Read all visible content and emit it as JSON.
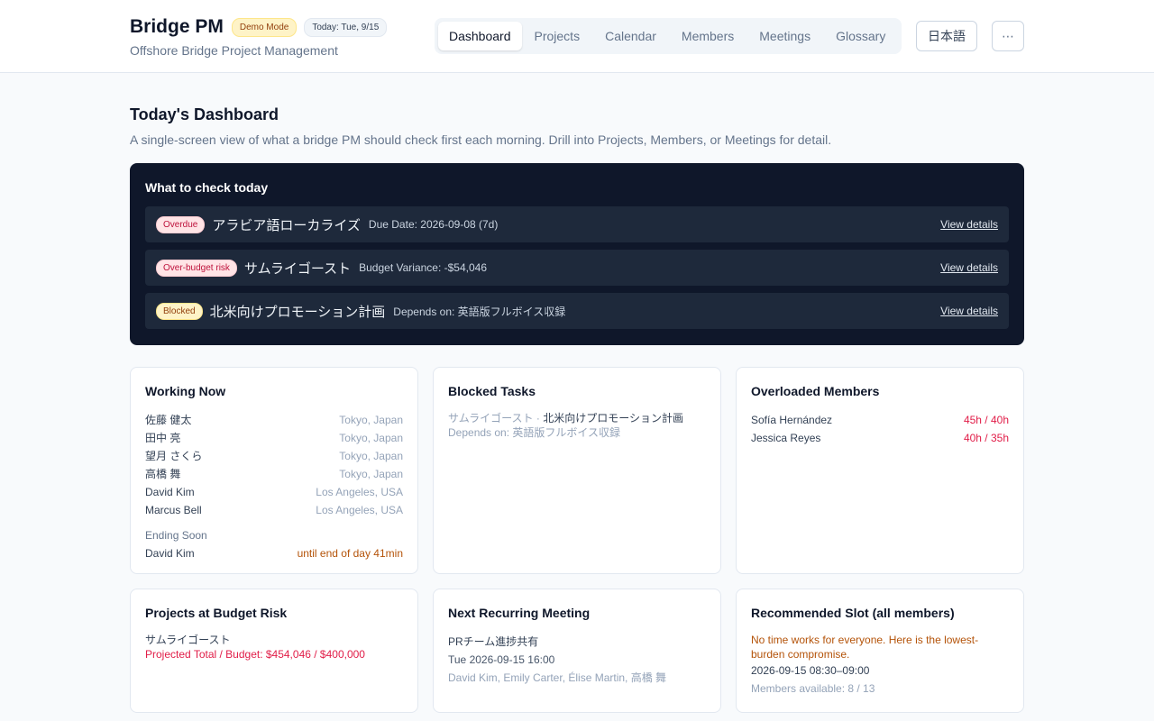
{
  "header": {
    "title": "Bridge PM",
    "demo_badge": "Demo Mode",
    "today_badge": "Today: Tue, 9/15",
    "subtitle": "Offshore Bridge Project Management",
    "nav": [
      "Dashboard",
      "Projects",
      "Calendar",
      "Members",
      "Meetings",
      "Glossary"
    ],
    "active_tab": "Dashboard",
    "language_button": "日本語",
    "more_button": "⋯"
  },
  "page": {
    "title": "Today's Dashboard",
    "description": "A single-screen view of what a bridge PM should check first each morning. Drill into Projects, Members, or Meetings for detail."
  },
  "check_today": {
    "title": "What to check today",
    "items": [
      {
        "badge": "Overdue",
        "name": "アラビア語ローカライズ",
        "detail": "Due Date: 2026-09-08 (7d)",
        "link": "View details"
      },
      {
        "badge": "Over-budget risk",
        "name": "サムライゴースト",
        "detail": "Budget Variance: -$54,046",
        "link": "View details"
      },
      {
        "badge": "Blocked",
        "name": "北米向けプロモーション計画",
        "detail": "Depends on: 英語版フルボイス収録",
        "link": "View details"
      }
    ]
  },
  "working_now": {
    "title": "Working Now",
    "members": [
      {
        "name": "佐藤 健太",
        "location": "Tokyo, Japan"
      },
      {
        "name": "田中 亮",
        "location": "Tokyo, Japan"
      },
      {
        "name": "望月 さくら",
        "location": "Tokyo, Japan"
      },
      {
        "name": "高橋 舞",
        "location": "Tokyo, Japan"
      },
      {
        "name": "David Kim",
        "location": "Los Angeles, USA"
      },
      {
        "name": "Marcus Bell",
        "location": "Los Angeles, USA"
      }
    ],
    "ending_soon_label": "Ending Soon",
    "ending_soon": [
      {
        "name": "David Kim",
        "until": "until end of day 41min"
      }
    ]
  },
  "blocked_tasks": {
    "title": "Blocked Tasks",
    "items": [
      {
        "project": "サムライゴースト",
        "separator": " · ",
        "task": "北米向けプロモーション計画",
        "depends": "Depends on: 英語版フルボイス収録"
      }
    ]
  },
  "overloaded": {
    "title": "Overloaded Members",
    "members": [
      {
        "name": "Sofía Hernández",
        "hours": "45h / 40h"
      },
      {
        "name": "Jessica Reyes",
        "hours": "40h / 35h"
      }
    ]
  },
  "budget_risk": {
    "title": "Projects at Budget Risk",
    "project": "サムライゴースト",
    "detail": "Projected Total / Budget: $454,046 / $400,000"
  },
  "next_meeting": {
    "title": "Next Recurring Meeting",
    "name": "PRチーム進捗共有",
    "time": "Tue 2026-09-15 16:00",
    "attendees": "David Kim, Emily Carter, Élise Martin, 高橋 舞"
  },
  "recommended_slot": {
    "title": "Recommended Slot (all members)",
    "note": "No time works for everyone. Here is the lowest-burden compromise.",
    "slot": "2026-09-15 08:30–09:00",
    "available": "Members available: 8 / 13"
  }
}
